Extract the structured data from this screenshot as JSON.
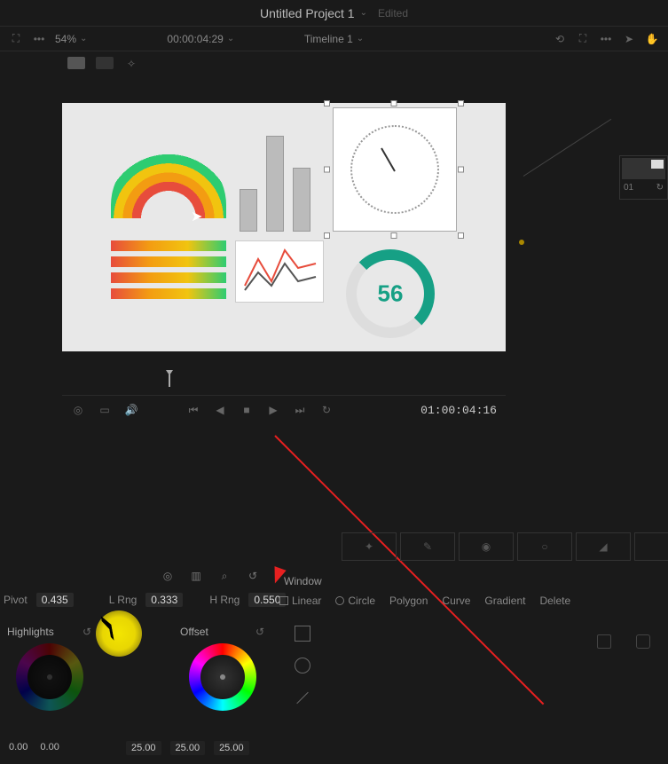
{
  "topbar": {
    "project_title": "Untitled Project 1",
    "edited_label": "Edited"
  },
  "toolbar": {
    "zoom": "54%",
    "timeline_label": "Timeline 1",
    "timecode": "00:00:04:29"
  },
  "transport": {
    "timecode_right": "01:00:04:16"
  },
  "mini_panel": {
    "label": "01"
  },
  "window_tab": "Window",
  "pivot": {
    "label": "Pivot",
    "value": "0.435"
  },
  "lrng": {
    "label": "L Rng",
    "value": "0.333"
  },
  "hrng": {
    "label": "H Rng",
    "value": "0.550"
  },
  "shapes": {
    "linear": "Linear",
    "circle": "Circle",
    "polygon": "Polygon",
    "curve": "Curve",
    "gradient": "Gradient",
    "delete": "Delete"
  },
  "wheels": {
    "highlights": {
      "label": "Highlights"
    },
    "offset": {
      "label": "Offset",
      "v1": "25.00",
      "v2": "25.00",
      "v3": "25.00"
    },
    "bottom_left": {
      "v1": "0.00",
      "v2": "0.00"
    }
  },
  "chart_data": {
    "type": "dashboard-thumbnail",
    "donut_value": "56"
  }
}
